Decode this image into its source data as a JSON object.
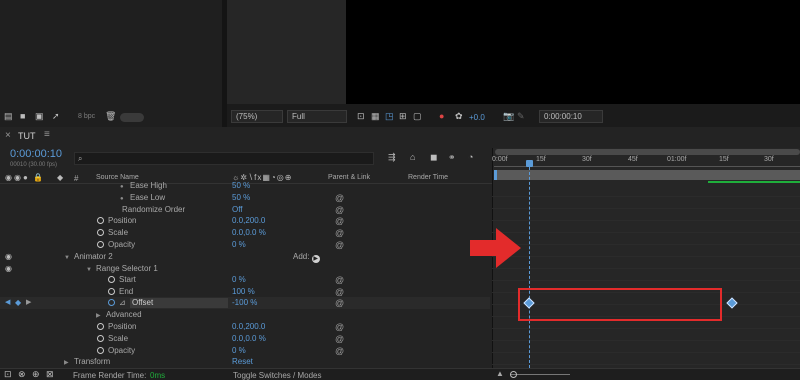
{
  "top_left": {
    "bpc_label": "8 bpc"
  },
  "viewer_toolbar": {
    "zoom": "(75%)",
    "resolution": "Full",
    "exposure": "+0.0",
    "timecode": "0:00:00:10"
  },
  "comp_tab": {
    "name": "TUT",
    "menu_glyph": "≡",
    "close_glyph": "×"
  },
  "timecode": {
    "current": "0:00:00:10",
    "frame_info": "00010 (30.00 fps)"
  },
  "search": {
    "placeholder": ""
  },
  "columns": {
    "number": "#",
    "source_name": "Source Name",
    "parent_link": "Parent & Link",
    "render_time": "Render Time"
  },
  "layers": [
    {
      "name": "Ease High",
      "value": "50 %"
    },
    {
      "name": "Ease Low",
      "value": "50 %"
    },
    {
      "name": "Randomize Order",
      "value": "Off"
    },
    {
      "name": "Position",
      "value": "0.0,200.0"
    },
    {
      "name": "Scale",
      "value": "0.0,0.0 %"
    },
    {
      "name": "Opacity",
      "value": "0 %"
    },
    {
      "name": "Animator 2",
      "value": "Add:"
    },
    {
      "name": "Range Selector 1",
      "value": ""
    },
    {
      "name": "Start",
      "value": "0 %"
    },
    {
      "name": "End",
      "value": "100 %"
    },
    {
      "name": "Offset",
      "value": "-100 %"
    },
    {
      "name": "Advanced",
      "value": ""
    },
    {
      "name": "Position",
      "value": "0.0,200.0"
    },
    {
      "name": "Scale",
      "value": "0.0,0.0 %"
    },
    {
      "name": "Opacity",
      "value": "0 %"
    },
    {
      "name": "Transform",
      "value": "Reset"
    }
  ],
  "ruler": [
    "0:00f",
    "15f",
    "30f",
    "45f",
    "01:00f",
    "15f",
    "30f"
  ],
  "keyframes": {
    "playhead_frame": 10,
    "key_frames": [
      10,
      70
    ],
    "visible_frames": 90
  },
  "bottom_bar": {
    "frame_render_label": "Frame Render Time:",
    "frame_render_value": "0ms",
    "toggle_label": "Toggle Switches / Modes"
  },
  "colors": {
    "accent_blue": "#5b9bd8",
    "highlight_red": "#e32b2b",
    "work_area_green": "#1fae3b",
    "panel_bg": "#232323"
  }
}
